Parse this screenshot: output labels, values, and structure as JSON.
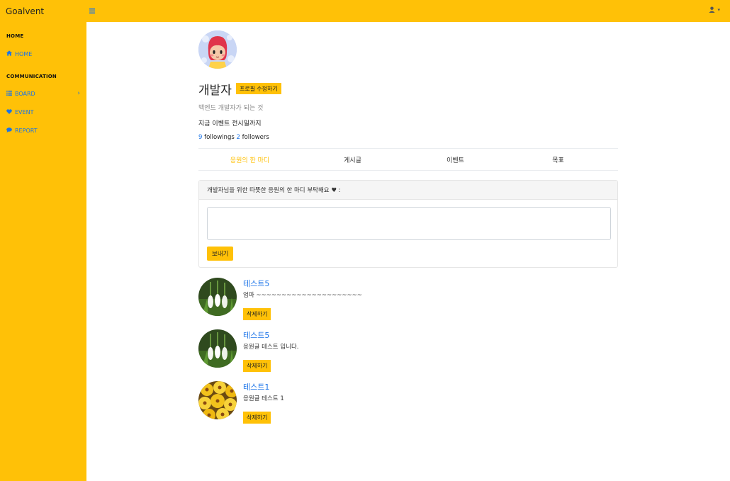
{
  "app": {
    "brand": "Goalvent"
  },
  "topbar": {
    "menu_icon": "hamburger-icon",
    "user_icon": "user-icon",
    "caret": "▾"
  },
  "sidebar": {
    "sections": [
      {
        "heading": "HOME",
        "items": [
          {
            "label": "HOME",
            "icon": "home-icon"
          }
        ]
      },
      {
        "heading": "COMMUNICATION",
        "items": [
          {
            "label": "BOARD",
            "icon": "list-icon",
            "has_chevron": true
          },
          {
            "label": "EVENT",
            "icon": "heart-icon"
          },
          {
            "label": "REPORT",
            "icon": "comment-icon"
          }
        ]
      }
    ]
  },
  "profile": {
    "name": "개발자",
    "edit_label": "프로필 수정하기",
    "bio": "백엔드 개발자가 되는 것",
    "goal": "지금 이벤트 전시일까지",
    "followings_count": "9",
    "followings_label": " followings ",
    "followers_count": "2",
    "followers_label": " followers"
  },
  "tabs": [
    {
      "label": "응원의 한 마디",
      "active": true
    },
    {
      "label": "게시글",
      "active": false
    },
    {
      "label": "이벤트",
      "active": false
    },
    {
      "label": "목표",
      "active": false
    }
  ],
  "cheer": {
    "header": "개발자님을 위한 따뜻한 응원의 한 마디 부탁해요 ♥ :",
    "textarea_value": "",
    "send_label": "보내기"
  },
  "comments": [
    {
      "name": "테스트5",
      "text": "엄마 ~~~~~~~~~~~~~~~~~~~~~",
      "delete_label": "삭제하기",
      "avatar": "snowdrop"
    },
    {
      "name": "테스트5",
      "text": "응원글 테스트 입니다.",
      "delete_label": "삭제하기",
      "avatar": "snowdrop"
    },
    {
      "name": "테스트1",
      "text": "응원글 테스트 1",
      "delete_label": "삭제하기",
      "avatar": "flowers"
    }
  ],
  "colors": {
    "accent": "#ffc107",
    "link": "#1a73e8"
  }
}
